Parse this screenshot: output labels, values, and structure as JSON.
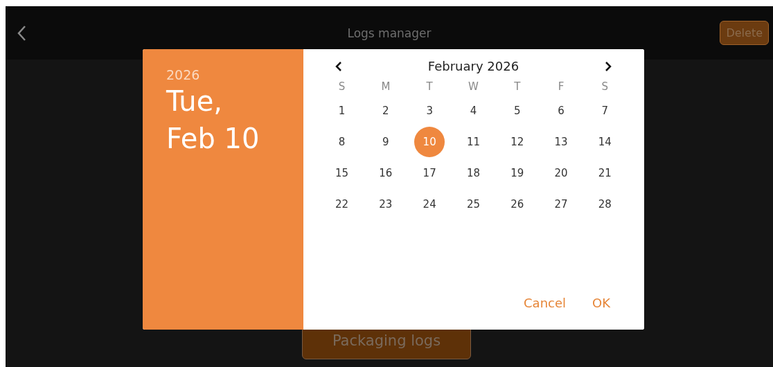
{
  "top_bar": {
    "title": "Logs manager",
    "delete_button": {
      "label": "Delete",
      "disabled": true
    }
  },
  "page": {
    "button": "Packaging logs"
  },
  "date_dialog": {
    "year": "2026",
    "date_line_1": "Tue,",
    "date_line_2": "Feb 10",
    "month": "February 2026",
    "weekdays": [
      "S",
      "M",
      "T",
      "W",
      "T",
      "F",
      "S"
    ],
    "days": [
      {
        "label": "1",
        "selected": false
      },
      {
        "label": "2",
        "selected": false
      },
      {
        "label": "3",
        "selected": false
      },
      {
        "label": "4",
        "selected": false
      },
      {
        "label": "5",
        "selected": false
      },
      {
        "label": "6",
        "selected": false
      },
      {
        "label": "7",
        "selected": false
      },
      {
        "label": "8",
        "selected": false
      },
      {
        "label": "9",
        "selected": false
      },
      {
        "label": "10",
        "selected": true
      },
      {
        "label": "11",
        "selected": false
      },
      {
        "label": "12",
        "selected": false
      },
      {
        "label": "13",
        "selected": false
      },
      {
        "label": "14",
        "selected": false
      },
      {
        "label": "15",
        "selected": false
      },
      {
        "label": "16",
        "selected": false
      },
      {
        "label": "17",
        "selected": false
      },
      {
        "label": "18",
        "selected": false
      },
      {
        "label": "19",
        "selected": false
      },
      {
        "label": "20",
        "selected": false
      },
      {
        "label": "21",
        "selected": false
      },
      {
        "label": "22",
        "selected": false
      },
      {
        "label": "23",
        "selected": false
      },
      {
        "label": "24",
        "selected": false
      },
      {
        "label": "25",
        "selected": false
      },
      {
        "label": "26",
        "selected": false
      },
      {
        "label": "27",
        "selected": false
      },
      {
        "label": "28",
        "selected": false
      }
    ],
    "buttons": [
      "Cancel",
      "OK"
    ]
  }
}
